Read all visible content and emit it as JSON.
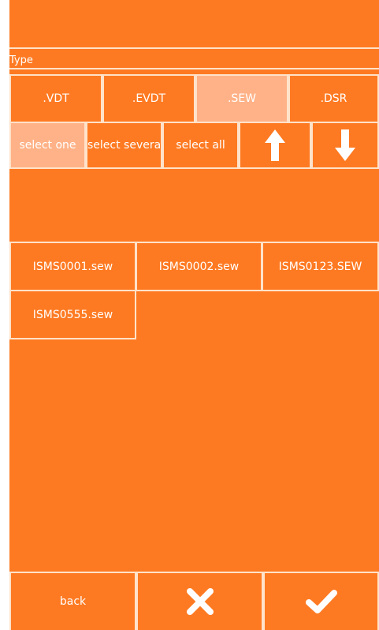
{
  "type_section": {
    "label": "Type",
    "tabs": [
      {
        "label": ".VDT",
        "selected": false
      },
      {
        "label": ".EVDT",
        "selected": false
      },
      {
        "label": ".SEW",
        "selected": true
      },
      {
        "label": ".DSR",
        "selected": false
      }
    ]
  },
  "selection": {
    "select_one": "select one",
    "select_several": "select several",
    "select_all": "select all",
    "up_icon": "arrow-up-icon",
    "down_icon": "arrow-down-icon"
  },
  "files": [
    "ISMS0001.sew",
    "ISMS0002.sew",
    "ISMS0123.SEW",
    "ISMS0555.sew"
  ],
  "footer": {
    "back": "back",
    "cancel_icon": "close-icon",
    "confirm_icon": "checkmark-icon"
  },
  "colors": {
    "background": "#fe7a22",
    "selected": "#ffb287",
    "border": "#ffe2c9"
  }
}
